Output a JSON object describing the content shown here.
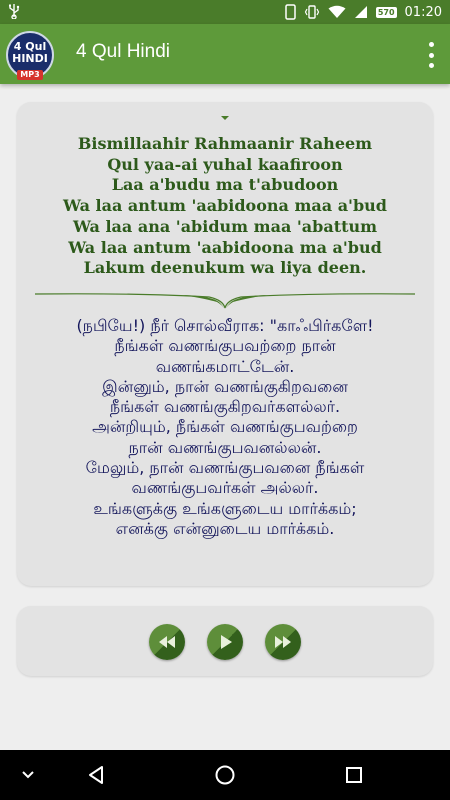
{
  "status_bar": {
    "time": "01:20",
    "battery": "570",
    "icons": [
      "usb-icon",
      "phone-icon",
      "vibrate-icon",
      "wifi-icon",
      "signal-icon",
      "battery-icon"
    ]
  },
  "app_bar": {
    "logo_line1": "4 Qul",
    "logo_line2": "HINDI",
    "logo_line3": "MP3",
    "title": "4 Qul Hindi",
    "menu_icon": "more-vert-icon"
  },
  "verse": {
    "transliteration": [
      "Bismillaahir Rahmaanir Raheem",
      "Qul yaa-ai yuhal kaafiroon",
      "Laa a'budu ma t'abudoon",
      "Wa laa antum 'aabidoona maa a'bud",
      "Wa laa ana 'abidum maa 'abattum",
      "Wa laa antum 'aabidoona ma a'bud",
      "Lakum deenukum wa liya deen."
    ],
    "translation": [
      "(நபியே!) நீர் சொல்வீராக: \"காஃபிர்களே!",
      "நீங்கள் வணங்குபவற்றை நான்",
      "வணங்கமாட்டேன்.",
      "இன்னும், நான் வணங்குகிறவனை",
      "நீங்கள் வணங்குகிறவர்களல்லர்.",
      "அன்றியும், நீங்கள் வணங்குபவற்றை",
      "நான் வணங்குபவனல்லன்.",
      "மேலும், நான் வணங்குபவனை நீங்கள்",
      "வணங்குபவர்கள் அல்லர்.",
      "உங்களுக்கு உங்களுடைய மார்க்கம்;",
      "எனக்கு என்னுடைய மார்க்கம்."
    ]
  },
  "player": {
    "controls": [
      "rewind-icon",
      "play-icon",
      "fast-forward-icon"
    ]
  },
  "nav_bar": {
    "items": [
      "chevron-down-icon",
      "back-icon",
      "home-icon",
      "recents-icon"
    ]
  },
  "colors": {
    "status_bar": "#4a7c2a",
    "app_bar": "#5e9a3a",
    "transliteration_text": "#2d5a1b",
    "translation_text": "#15175c",
    "card_background": "#e3e3e3"
  }
}
